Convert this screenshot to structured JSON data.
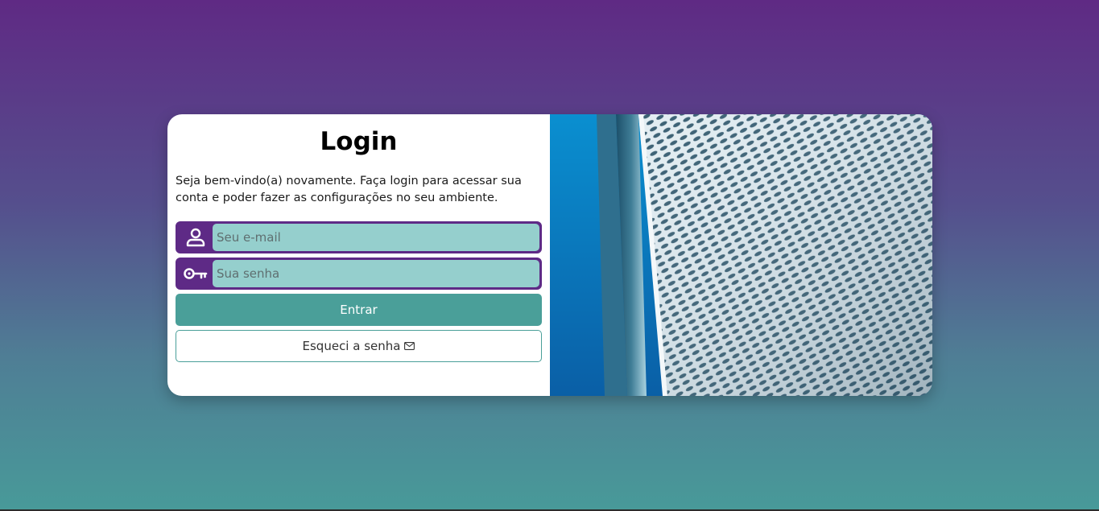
{
  "login": {
    "title": "Login",
    "intro": "Seja bem-vindo(a) novamente. Faça login para acessar sua conta e poder fazer as configurações no seu ambiente.",
    "email_placeholder": "Seu e-mail",
    "password_placeholder": "Sua senha",
    "submit_label": "Entrar",
    "forgot_label": "Esqueci a senha"
  },
  "icons": {
    "email": "user-icon",
    "password": "key-icon",
    "forgot": "envelope-icon"
  },
  "colors": {
    "purple": "#5e2a86",
    "input_bg": "#95cfcd",
    "teal": "#4a9f99",
    "bg_top": "#5f2a84",
    "bg_bottom": "#489a99"
  }
}
